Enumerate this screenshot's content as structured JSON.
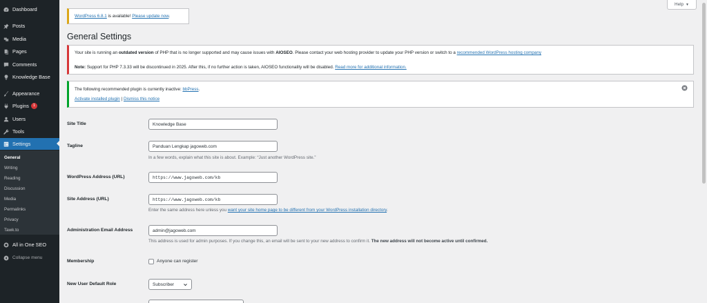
{
  "sidebar": {
    "menu": [
      {
        "label": "Dashboard",
        "icon": "dashboard-icon"
      },
      {
        "label": "Posts",
        "icon": "pin-icon"
      },
      {
        "label": "Media",
        "icon": "media-icon"
      },
      {
        "label": "Pages",
        "icon": "pages-icon"
      },
      {
        "label": "Comments",
        "icon": "comments-icon"
      },
      {
        "label": "Knowledge Base",
        "icon": "lightbulb-icon"
      },
      {
        "label": "Appearance",
        "icon": "brush-icon"
      },
      {
        "label": "Plugins",
        "icon": "plugin-icon",
        "badge": "1"
      },
      {
        "label": "Users",
        "icon": "users-icon"
      },
      {
        "label": "Tools",
        "icon": "wrench-icon"
      },
      {
        "label": "Settings",
        "icon": "settings-icon"
      }
    ],
    "submenu": [
      "General",
      "Writing",
      "Reading",
      "Discussion",
      "Media",
      "Permalinks",
      "Privacy",
      "Tawk.to"
    ],
    "aioseo": "All in One SEO",
    "collapse": "Collapse menu"
  },
  "help": {
    "label": "Help"
  },
  "update_nag": {
    "link1": "WordPress 6.8.1",
    "mid": "is available!",
    "link2": "Please update now"
  },
  "page_title": "General Settings",
  "php_notice": {
    "line1_pre": "Your site is running an",
    "line1_bold": "outdated version",
    "line1_mid": "of PHP that is no longer supported and may cause issues with",
    "line1_bold2": "AIOSEO",
    "line1_post": ". Please contact your web hosting provider to update your PHP version or switch to a",
    "line1_link": "recommended WordPress hosting company",
    "line2_bold": "Note:",
    "line2_text": "Support for PHP 7.3.33 will be discontinued in 2025. After this, if no further action is taken, AIOSEO functionality will be disabled.",
    "line2_link": "Read more for additional information."
  },
  "plugin_notice": {
    "text": "The following recommended plugin is currently inactive:",
    "plugin": "bbPress",
    "activate": "Activate installed plugin",
    "sep": "|",
    "dismiss": "Dismiss this notice"
  },
  "form": {
    "site_title": {
      "label": "Site Title",
      "value": "Knowledge Base"
    },
    "tagline": {
      "label": "Tagline",
      "value": "Panduan Lengkap jagoweb.com",
      "desc": "In a few words, explain what this site is about. Example: “Just another WordPress site.”"
    },
    "wp_address": {
      "label": "WordPress Address (URL)",
      "value": "https://www.jagoweb.com/kb"
    },
    "site_address": {
      "label": "Site Address (URL)",
      "value": "https://www.jagoweb.com/kb",
      "desc_pre": "Enter the same address here unless you",
      "desc_link": "want your site home page to be different from your WordPress installation directory",
      "desc_post": "."
    },
    "admin_email": {
      "label": "Administration Email Address",
      "value": "admin@jagoweb.com",
      "desc_pre": "This address is used for admin purposes. If you change this, an email will be sent to your new address to confirm it.",
      "desc_bold": "The new address will not become active until confirmed."
    },
    "membership": {
      "label": "Membership",
      "checkbox_label": "Anyone can register",
      "checked": false
    },
    "default_role": {
      "label": "New User Default Role",
      "value": "Subscriber"
    }
  },
  "colors": {
    "sidebar_bg": "#1d2327",
    "accent": "#2271b1",
    "error": "#d63638",
    "success": "#00a32a",
    "warning": "#dba617"
  }
}
